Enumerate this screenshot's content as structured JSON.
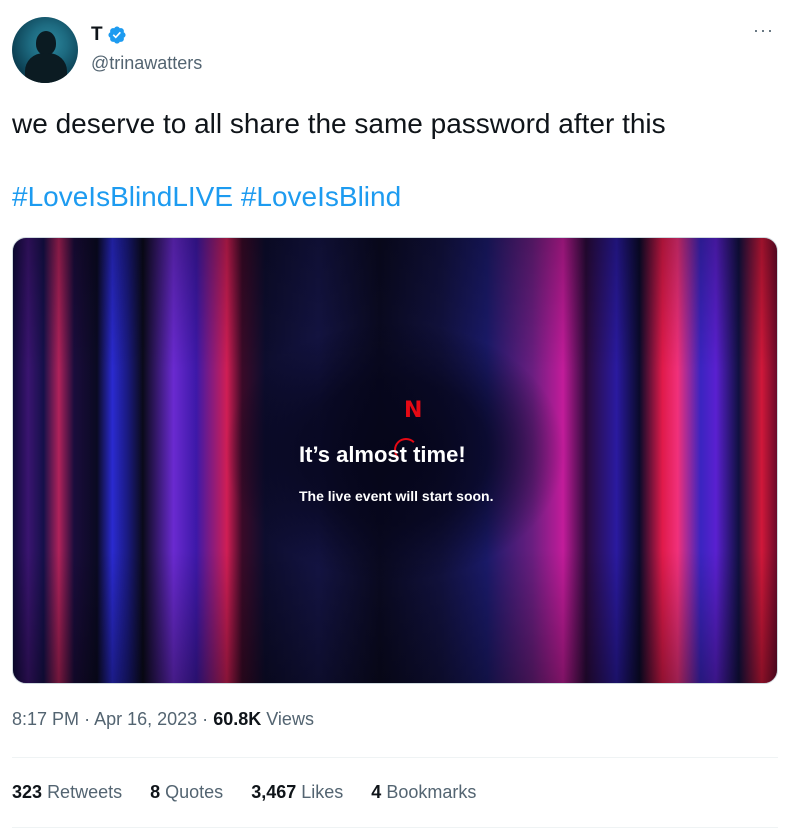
{
  "author": {
    "display_name": "T",
    "handle": "@trinawatters",
    "verified_badge_icon": "verified-badge-icon",
    "more_icon": "more-options-icon"
  },
  "tweet": {
    "text": "we deserve to all share the same password after this",
    "hashtags": [
      "#LoveIsBlindLIVE",
      "#LoveIsBlind"
    ]
  },
  "media": {
    "logo_letter": "N",
    "headline": "It’s almost time!",
    "subline": "The live event will start soon."
  },
  "meta": {
    "time": "8:17 PM",
    "separator": "·",
    "date": "Apr 16, 2023",
    "views_count": "60.8K",
    "views_label": "Views"
  },
  "stats": [
    {
      "count": "323",
      "label": "Retweets"
    },
    {
      "count": "8",
      "label": "Quotes"
    },
    {
      "count": "3,467",
      "label": "Likes"
    },
    {
      "count": "4",
      "label": "Bookmarks"
    }
  ],
  "colors": {
    "link": "#1d9bf0",
    "secondary_text": "#536471",
    "primary_text": "#0f1419",
    "netflix_red": "#e50914"
  }
}
